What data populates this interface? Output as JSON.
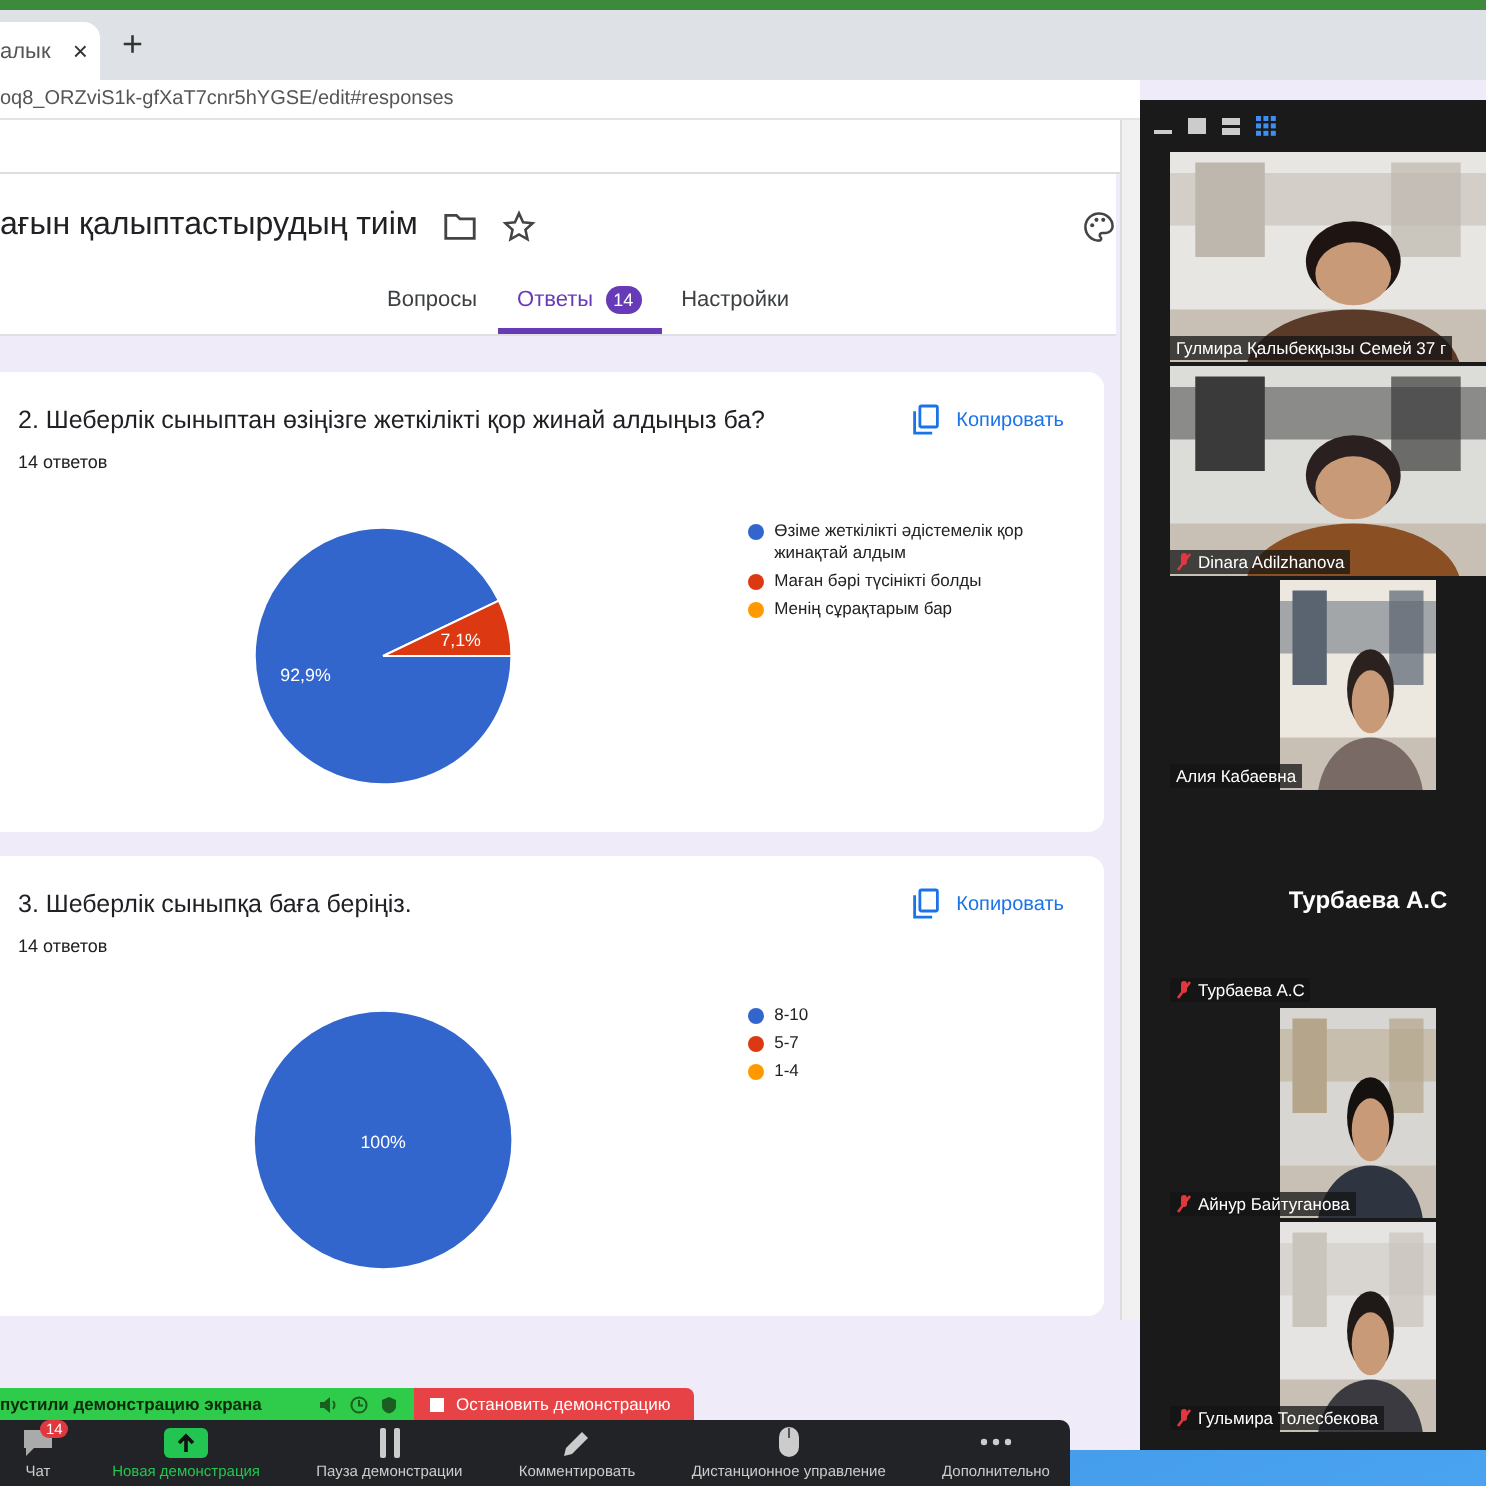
{
  "browser": {
    "tab": {
      "title": "алык",
      "close": "×"
    },
    "new_tab": "+",
    "address": "oq8_ORZviS1k-gfXaT7cnr5hYGSE/edit#responses"
  },
  "form": {
    "title": "ағын қалыптастырудың тиім",
    "tabs": [
      {
        "label": "Вопросы",
        "selected": false
      },
      {
        "label": "Ответы",
        "selected": true,
        "badge": "14"
      },
      {
        "label": "Настройки",
        "selected": false
      }
    ]
  },
  "questions": [
    {
      "title": "2. Шеберлік сыныптан өзіңізге жеткілікті қор жинай алдыңыз ба?",
      "count": "14 ответов",
      "copy": "Копировать",
      "chart_data": {
        "type": "pie",
        "categories": [
          "Өзіме жеткілікті әдістемелік қор жинақтай алдым",
          "Маған бәрі түсінікті болды",
          "Менің сұрақтарым бар"
        ],
        "colors": [
          "#3366cc",
          "#dc3912",
          "#ff9900"
        ],
        "legend": "right",
        "values": [
          92.9,
          7.1,
          0
        ],
        "value_labels": [
          "92,9%",
          "7,1%",
          null
        ]
      }
    },
    {
      "title": "3. Шеберлік сыныпқа баға беріңіз.",
      "count": "14 ответов",
      "copy": "Копировать",
      "chart_data": {
        "type": "pie",
        "categories": [
          "8-10",
          "5-7",
          "1-4"
        ],
        "colors": [
          "#3366cc",
          "#dc3912",
          "#ff9900"
        ],
        "legend": "right",
        "values": [
          100,
          0,
          0
        ],
        "value_labels": [
          "100%",
          null,
          null
        ]
      }
    }
  ],
  "participants": [
    {
      "name": "Гулмира Қалыбекқызы Семей 37 г",
      "muted": false,
      "kind": "wide"
    },
    {
      "name": "Dinara Adilzhanova",
      "muted": true,
      "kind": "wide"
    },
    {
      "name": "Алия Кабаевна",
      "muted": false,
      "kind": "narrow"
    },
    {
      "name": "Турбаева А.С",
      "display_name": "Турбаева А.С",
      "muted": true,
      "kind": "off"
    },
    {
      "name": "Айнур Байтуганова",
      "muted": true,
      "kind": "narrow"
    },
    {
      "name": "Гульмира Толесбекова",
      "muted": true,
      "kind": "narrow"
    }
  ],
  "share_bar": {
    "status": "пустили демонстрацию экрана",
    "stop": "Остановить демонстрацию"
  },
  "toolbar": [
    {
      "kind": "chat",
      "label": "Чат",
      "badge": "14",
      "highlighted": false
    },
    {
      "kind": "share",
      "label": "Новая демонстрация",
      "highlighted": true
    },
    {
      "kind": "pause",
      "label": "Пауза демонстрации",
      "highlighted": false
    },
    {
      "kind": "annotate",
      "label": "Комментировать",
      "highlighted": false
    },
    {
      "kind": "remote",
      "label": "Дистанционное управление",
      "highlighted": false
    },
    {
      "kind": "more",
      "label": "Дополнительно",
      "highlighted": false
    }
  ]
}
